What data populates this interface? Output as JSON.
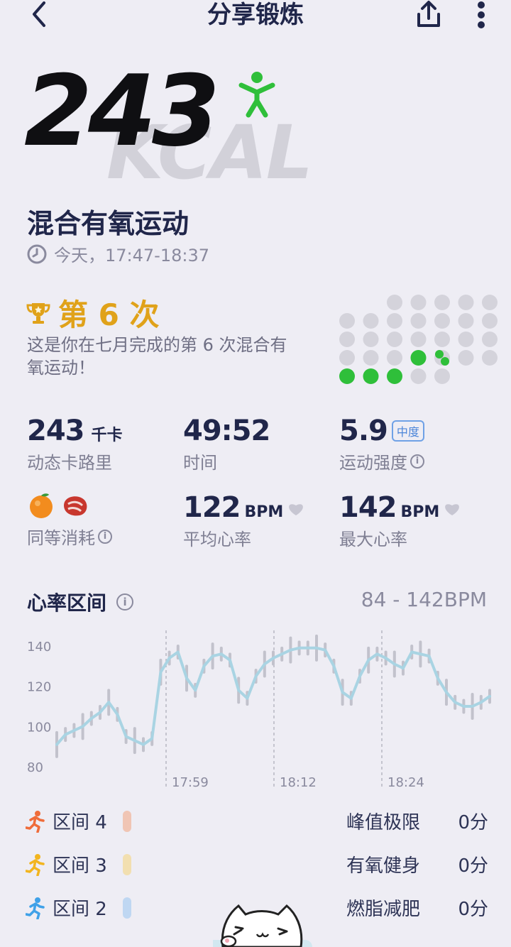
{
  "header": {
    "title": "分享锻炼"
  },
  "hero": {
    "calories": "243",
    "unit_bg": "KCAL"
  },
  "workout": {
    "title": "混合有氧运动",
    "time": "今天，17:47-18:37"
  },
  "achievement": {
    "title": "第 6 次",
    "description": "这是你在七月完成的第 6 次混合有氧运动！",
    "dot_colors": {
      "active": "#2fbf3a",
      "inactive": "#d4d3db"
    }
  },
  "stats": {
    "calories_value": "243",
    "calories_unit": "千卡",
    "calories_label": "动态卡路里",
    "time_value": "49:52",
    "time_label": "时间",
    "intensity_value": "5.9",
    "intensity_badge": "中度",
    "intensity_label": "运动强度",
    "equivalent_label": "同等消耗",
    "avg_hr_value": "122",
    "avg_hr_unit": "BPM",
    "avg_hr_label": "平均心率",
    "max_hr_value": "142",
    "max_hr_unit": "BPM",
    "max_hr_label": "最大心率"
  },
  "heart_zone": {
    "title": "心率区间",
    "range": "84 - 142BPM"
  },
  "chart_data": {
    "type": "line",
    "ylim": [
      80,
      140
    ],
    "y_ticks": [
      "140",
      "120",
      "100",
      "80"
    ],
    "x_ticks": [
      "17:59",
      "18:12",
      "18:24"
    ],
    "series": [
      {
        "values": [
          91,
          96,
          98,
          100,
          104,
          107,
          112,
          106,
          95,
          93,
          91,
          94,
          127,
          134,
          137,
          124,
          118,
          130,
          135,
          136,
          133,
          118,
          114,
          125,
          131,
          134,
          136,
          138,
          139,
          139,
          139,
          138,
          130,
          117,
          114,
          125,
          133,
          136,
          134,
          131,
          129,
          137,
          136,
          135,
          124,
          117,
          112,
          110,
          110,
          112,
          115
        ]
      }
    ],
    "colors": {
      "line": "#a9d4e3",
      "bar": "#c2c2cc",
      "grid": "#b6b6c2"
    }
  },
  "zones": [
    {
      "name": "区间 4",
      "label": "峰值极限",
      "value": "0分",
      "color": "#f0c5b4",
      "icon_color": "#ef6c3a"
    },
    {
      "name": "区间 3",
      "label": "有氧健身",
      "value": "0分",
      "color": "#f2dfb0",
      "icon_color": "#f2b51f"
    },
    {
      "name": "区间 2",
      "label": "燃脂减肥",
      "value": "0分",
      "color": "#bfd7f2",
      "icon_color": "#3fa1e8"
    }
  ]
}
